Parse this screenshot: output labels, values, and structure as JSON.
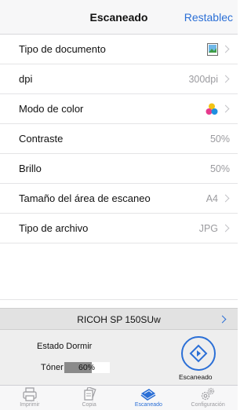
{
  "header": {
    "title": "Escaneado",
    "right_action": "Restablec"
  },
  "settings": [
    {
      "label": "Tipo de documento",
      "value": "",
      "icon": "photo-document-icon"
    },
    {
      "label": "dpi",
      "value": "300dpi",
      "icon": ""
    },
    {
      "label": "Modo de color",
      "value": "",
      "icon": "color-dots-icon"
    },
    {
      "label": "Contraste",
      "value": "50%",
      "icon": ""
    },
    {
      "label": "Brillo",
      "value": "50%",
      "icon": ""
    },
    {
      "label": "Tamaño del área de escaneo",
      "value": "A4",
      "icon": ""
    },
    {
      "label": "Tipo de archivo",
      "value": "JPG",
      "icon": ""
    }
  ],
  "printer": {
    "name": "RICOH SP 150SUw"
  },
  "status": {
    "state_label": "Estado Dormir",
    "toner_label": "Tóner",
    "toner_percent": "60%",
    "toner_level": 0.6,
    "scan_label": "Escaneado"
  },
  "tabs": [
    {
      "label": "Imprimir",
      "icon": "printer-icon",
      "active": false
    },
    {
      "label": "Copia",
      "icon": "copy-icon",
      "active": false
    },
    {
      "label": "Escaneado",
      "icon": "scan-icon",
      "active": true
    },
    {
      "label": "Configuración",
      "icon": "gear-icon",
      "active": false
    }
  ],
  "colors": {
    "accent": "#2b6fd6",
    "toner_fill": "#8a8a8a"
  }
}
